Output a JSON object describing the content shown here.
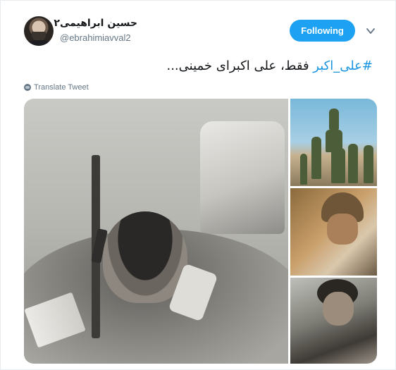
{
  "author": {
    "display_name": "حسین ابراهیمی۲",
    "handle": "@ebrahimiavval2"
  },
  "follow_button": {
    "label": "Following"
  },
  "tweet": {
    "hashtag": "#علی_اکبر",
    "text": " فقط، علی اکبرای خمینی..."
  },
  "translate": {
    "label": "Translate Tweet"
  },
  "colors": {
    "accent": "#1da1f2",
    "hashtag": "#1b95e0",
    "secondary_text": "#657786"
  },
  "icons": {
    "caret": "chevron-down-icon",
    "translate": "globe-icon"
  }
}
